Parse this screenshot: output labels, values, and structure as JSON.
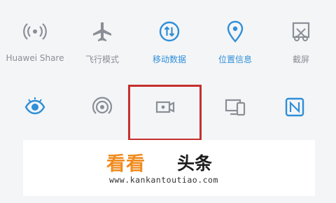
{
  "quick_settings": {
    "row1": [
      {
        "label": "Huawei Share",
        "icon": "huawei-share-icon",
        "active": false
      },
      {
        "label": "飞行模式",
        "icon": "airplane-icon",
        "active": false
      },
      {
        "label": "移动数据",
        "icon": "mobile-data-icon",
        "active": true
      },
      {
        "label": "位置信息",
        "icon": "location-icon",
        "active": true
      },
      {
        "label": "截屏",
        "icon": "screenshot-icon",
        "active": false
      }
    ],
    "row2": [
      {
        "icon": "eye-comfort-icon",
        "active": true
      },
      {
        "icon": "hotspot-icon",
        "active": false
      },
      {
        "icon": "screen-record-icon",
        "active": false
      },
      {
        "icon": "multi-screen-icon",
        "active": false
      },
      {
        "icon": "nfc-icon",
        "active": true
      }
    ]
  },
  "watermark_banner": {
    "brand_orange": "看看",
    "brand_black": "头条",
    "url": "www.kankantoutiao.com"
  },
  "colors": {
    "active": "#2f8fd8",
    "inactive": "#8a8f96",
    "highlight": "#c5302e",
    "brand_orange": "#f08b1f"
  }
}
